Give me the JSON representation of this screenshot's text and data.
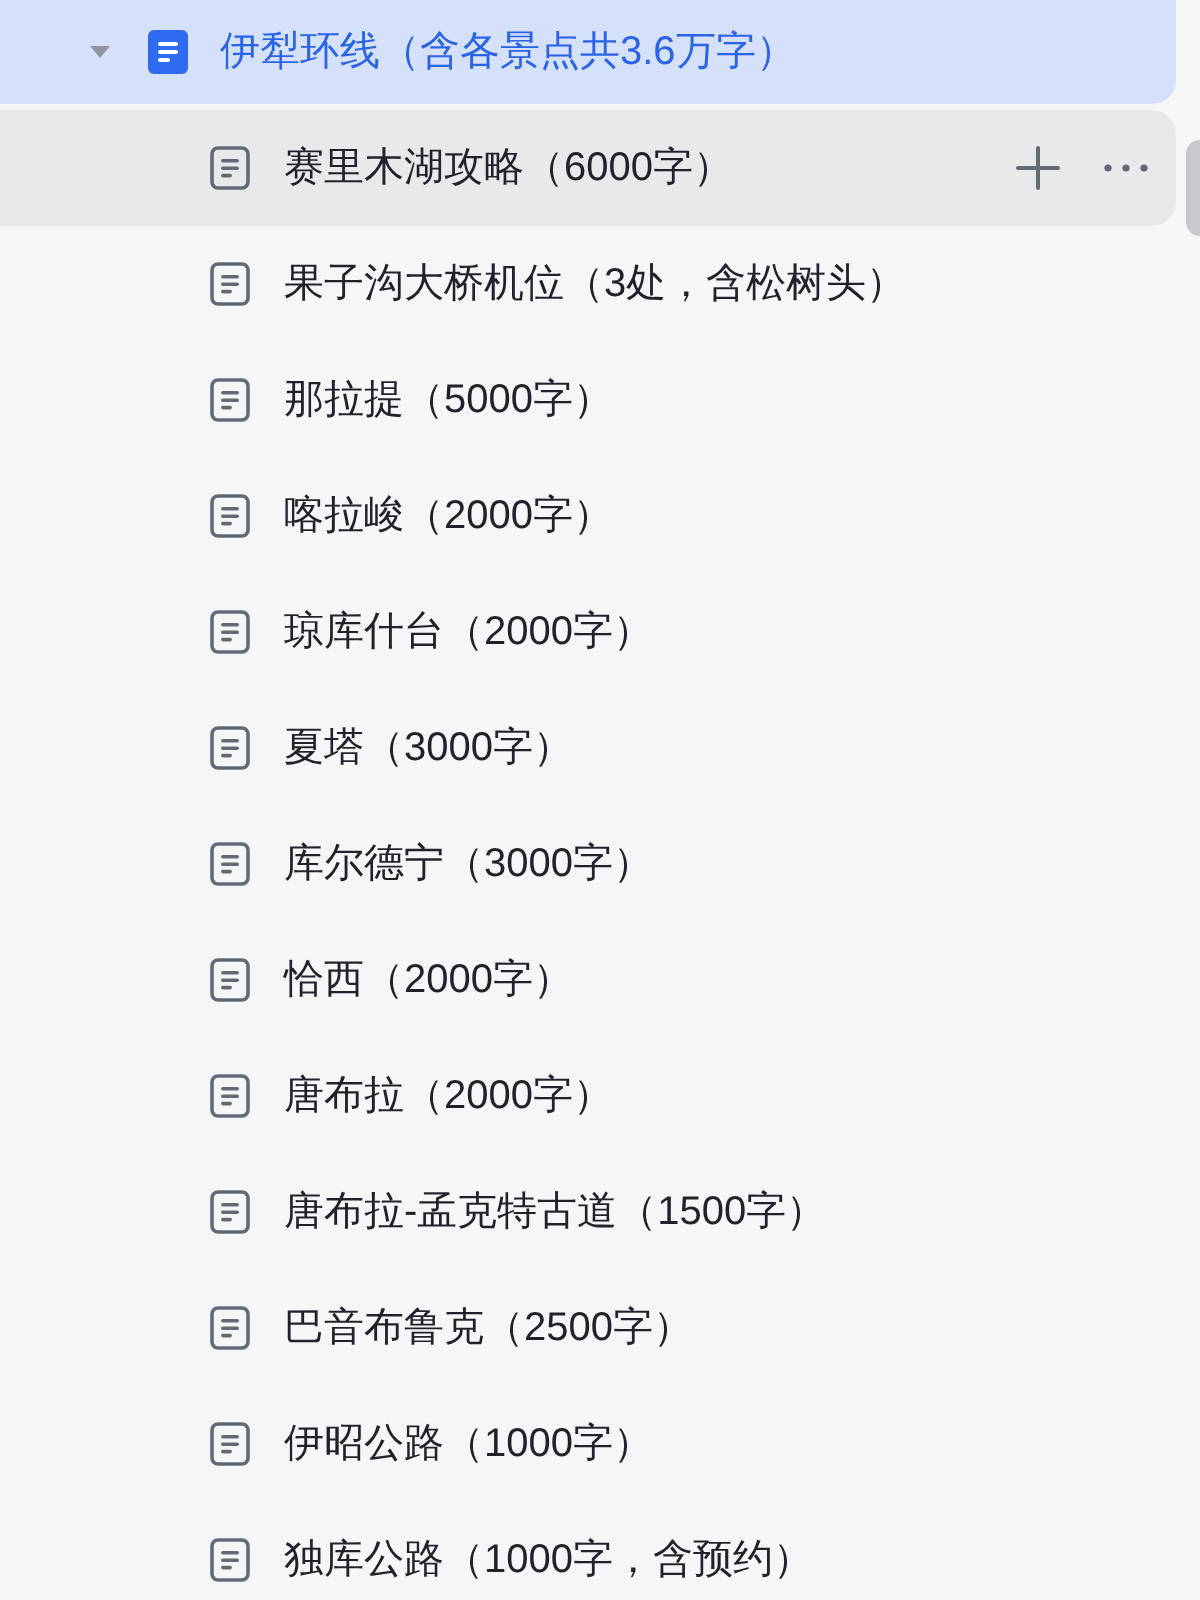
{
  "parent": {
    "title": "伊犁环线（含各景点共3.6万字）",
    "expanded": true,
    "selected": true
  },
  "children": [
    {
      "title": "赛里木湖攻略（6000字）",
      "hovered": true
    },
    {
      "title": "果子沟大桥机位（3处，含松树头）",
      "hovered": false
    },
    {
      "title": "那拉提（5000字）",
      "hovered": false
    },
    {
      "title": "喀拉峻（2000字）",
      "hovered": false
    },
    {
      "title": "琼库什台（2000字）",
      "hovered": false
    },
    {
      "title": "夏塔（3000字）",
      "hovered": false
    },
    {
      "title": "库尔德宁（3000字）",
      "hovered": false
    },
    {
      "title": "恰西（2000字）",
      "hovered": false
    },
    {
      "title": "唐布拉（2000字）",
      "hovered": false
    },
    {
      "title": "唐布拉-孟克特古道（1500字）",
      "hovered": false
    },
    {
      "title": "巴音布鲁克（2500字）",
      "hovered": false
    },
    {
      "title": "伊昭公路（1000字）",
      "hovered": false
    },
    {
      "title": "独库公路（1000字，含预约）",
      "hovered": false
    }
  ]
}
